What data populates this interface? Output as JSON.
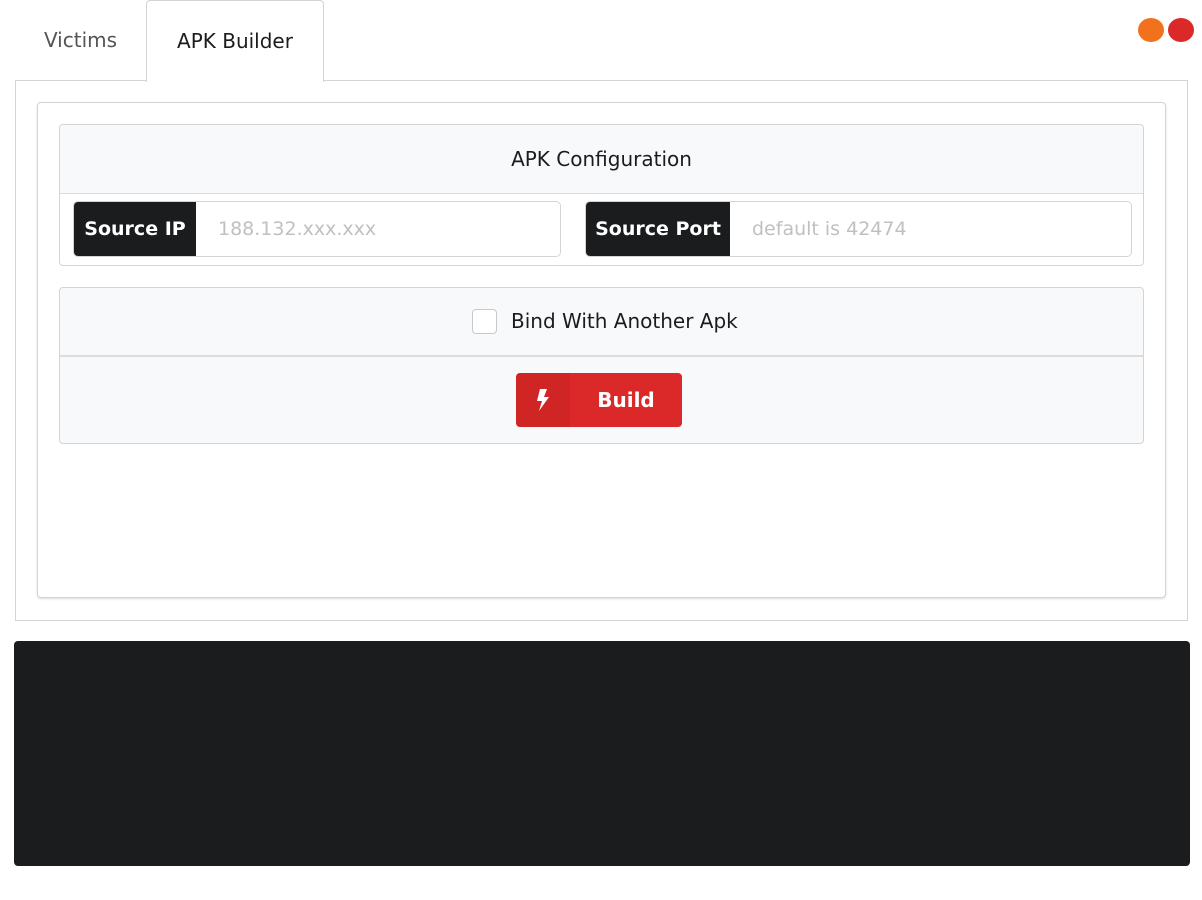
{
  "window_controls": {
    "minimize_color": "#f2711c",
    "close_color": "#db2828"
  },
  "tabs": [
    {
      "label": "Victims",
      "active": false
    },
    {
      "label": "APK Builder",
      "active": true
    }
  ],
  "config": {
    "header": "APK Configuration",
    "source_ip": {
      "label": "Source IP",
      "value": "",
      "placeholder": "188.132.xxx.xxx"
    },
    "source_port": {
      "label": "Source Port",
      "value": "",
      "placeholder": "default is 42474"
    }
  },
  "bind": {
    "label": "Bind With Another Apk",
    "checked": false
  },
  "build_button": {
    "label": "Build",
    "icon": "lightning-icon",
    "color": "#db2828"
  },
  "console": {
    "background": "#1b1c1d"
  }
}
